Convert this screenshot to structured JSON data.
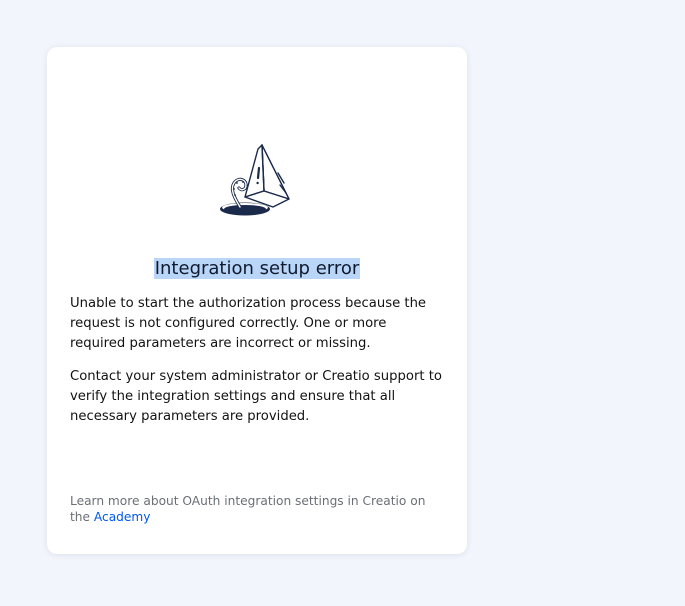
{
  "error": {
    "icon": "warning-triangle-tentacle-icon",
    "title": "Integration setup error",
    "message": "Unable to start the authorization process because the request is not configured correctly. One or more required parameters are incorrect or missing.",
    "instruction": "Contact your system administrator or Creatio support to verify the integration settings and ensure that all necessary parameters are provided."
  },
  "footer": {
    "text": "Learn more about OAuth integration settings in Creatio on the",
    "link_label": "Academy"
  },
  "colors": {
    "background": "#f2f5fc",
    "card": "#ffffff",
    "selection_highlight": "#b9d5f7",
    "link": "#0058ef",
    "illustration_stroke": "#1b2a4a"
  }
}
